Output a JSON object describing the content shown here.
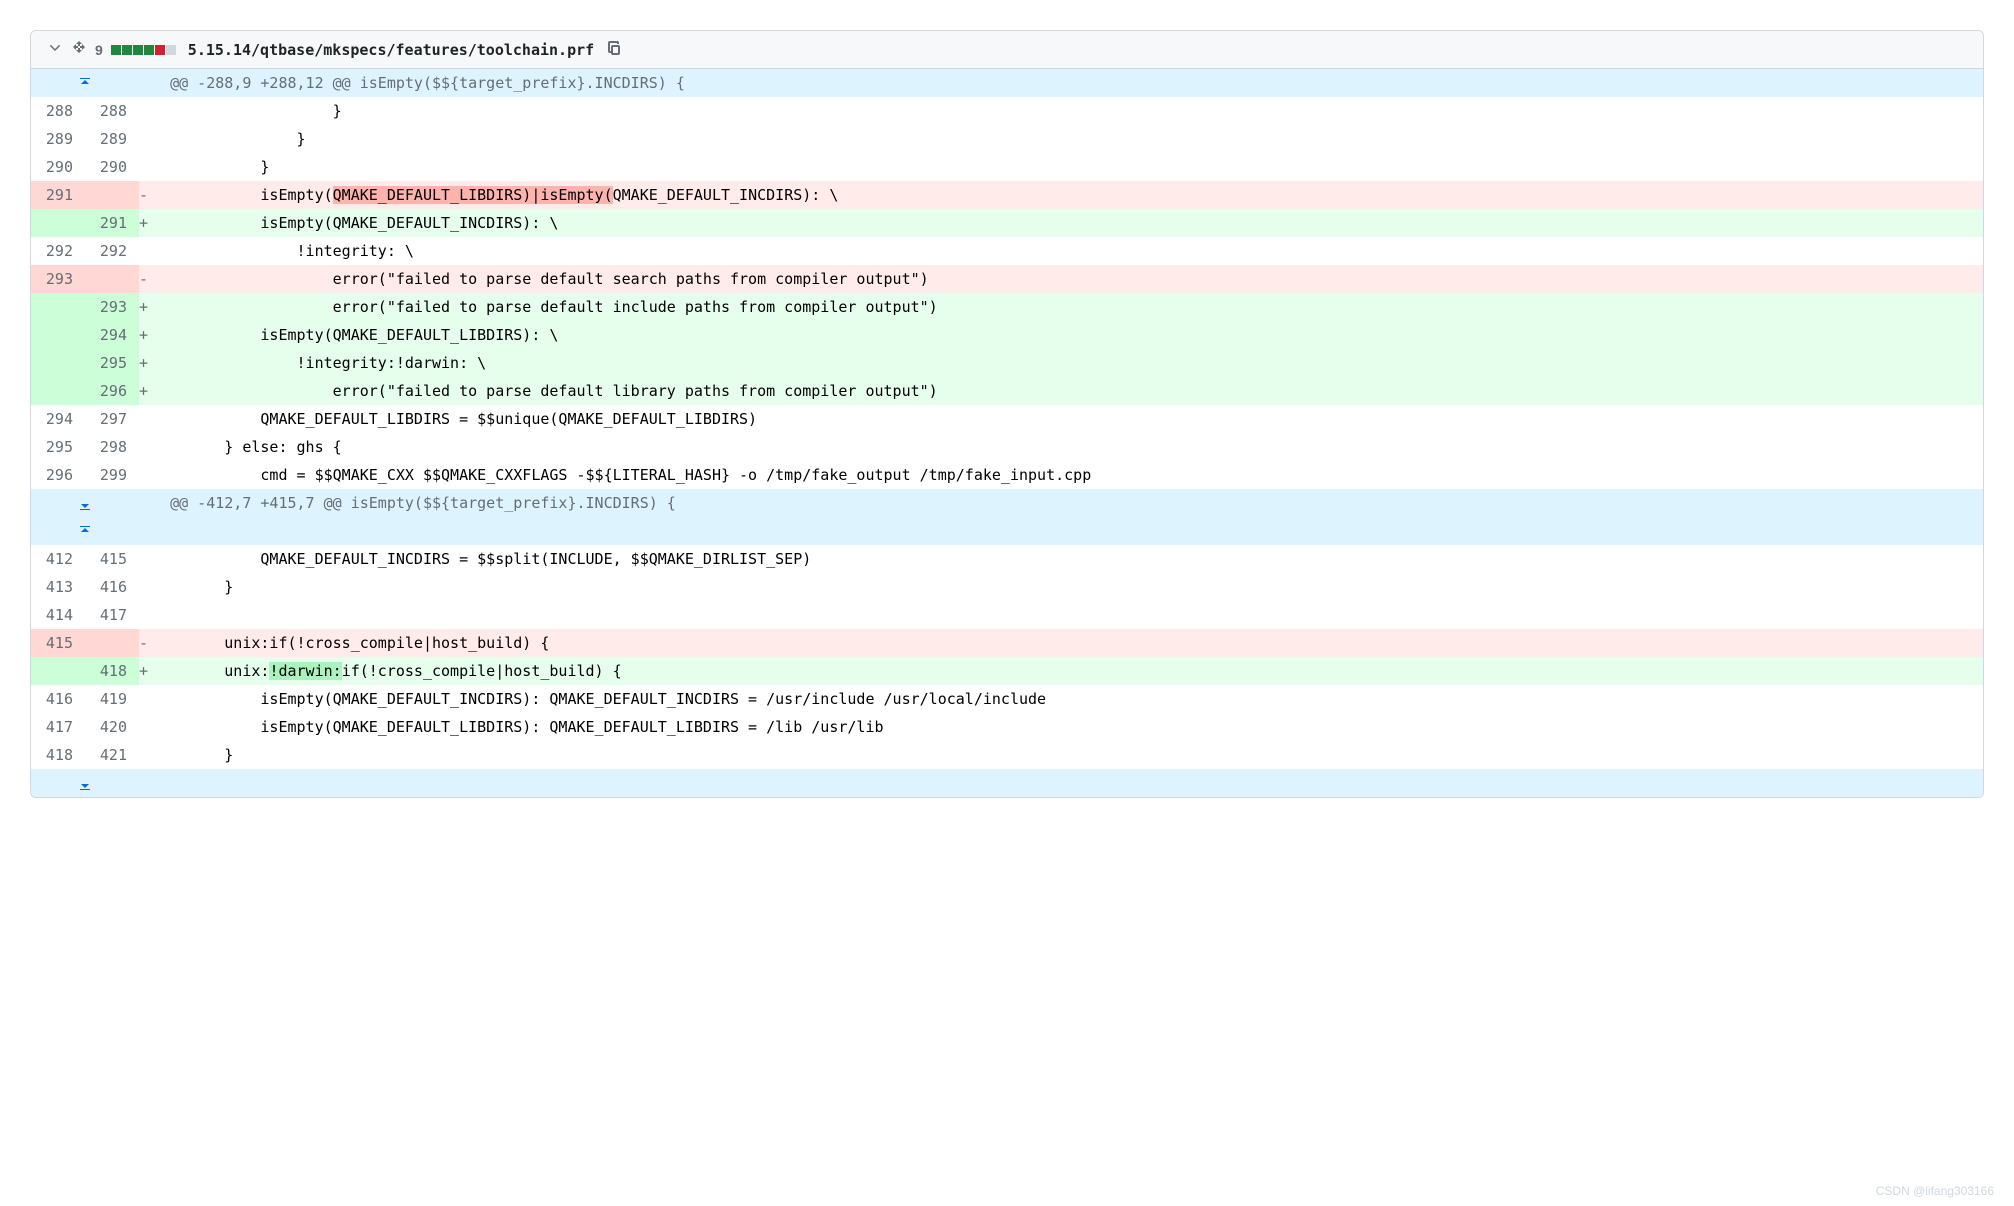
{
  "header": {
    "change_count": "9",
    "file_path": "5.15.14/qtbase/mkspecs/features/toolchain.prf",
    "stat_blocks": [
      "add",
      "add",
      "add",
      "add",
      "del",
      "neutral"
    ]
  },
  "hunks": [
    {
      "header": "@@ -288,9 +288,12 @@ isEmpty($${target_prefix}.INCDIRS) {",
      "expand_up": true,
      "expand_down": false
    },
    {
      "header": "@@ -412,7 +415,7 @@ isEmpty($${target_prefix}.INCDIRS) {",
      "expand_up": true,
      "expand_down": true
    }
  ],
  "rows": [
    {
      "type": "ctx",
      "old": "288",
      "new": "288",
      "code": "                    }"
    },
    {
      "type": "ctx",
      "old": "289",
      "new": "289",
      "code": "                }"
    },
    {
      "type": "ctx",
      "old": "290",
      "new": "290",
      "code": "            }"
    },
    {
      "type": "del",
      "old": "291",
      "new": "",
      "code_pre": "            isEmpty(",
      "hl": "QMAKE_DEFAULT_LIBDIRS)|isEmpty(",
      "code_post": "QMAKE_DEFAULT_INCDIRS): \\"
    },
    {
      "type": "add",
      "old": "",
      "new": "291",
      "code": "            isEmpty(QMAKE_DEFAULT_INCDIRS): \\"
    },
    {
      "type": "ctx",
      "old": "292",
      "new": "292",
      "code": "                !integrity: \\"
    },
    {
      "type": "del",
      "old": "293",
      "new": "",
      "code": "                    error(\"failed to parse default search paths from compiler output\")"
    },
    {
      "type": "add",
      "old": "",
      "new": "293",
      "code": "                    error(\"failed to parse default include paths from compiler output\")"
    },
    {
      "type": "add",
      "old": "",
      "new": "294",
      "code": "            isEmpty(QMAKE_DEFAULT_LIBDIRS): \\"
    },
    {
      "type": "add",
      "old": "",
      "new": "295",
      "code": "                !integrity:!darwin: \\"
    },
    {
      "type": "add",
      "old": "",
      "new": "296",
      "code": "                    error(\"failed to parse default library paths from compiler output\")"
    },
    {
      "type": "ctx",
      "old": "294",
      "new": "297",
      "code": "            QMAKE_DEFAULT_LIBDIRS = $$unique(QMAKE_DEFAULT_LIBDIRS)"
    },
    {
      "type": "ctx",
      "old": "295",
      "new": "298",
      "code": "        } else: ghs {"
    },
    {
      "type": "ctx",
      "old": "296",
      "new": "299",
      "code": "            cmd = $$QMAKE_CXX $$QMAKE_CXXFLAGS -$${LITERAL_HASH} -o /tmp/fake_output /tmp/fake_input.cpp"
    }
  ],
  "rows2": [
    {
      "type": "ctx",
      "old": "412",
      "new": "415",
      "code": "            QMAKE_DEFAULT_INCDIRS = $$split(INCLUDE, $$QMAKE_DIRLIST_SEP)"
    },
    {
      "type": "ctx",
      "old": "413",
      "new": "416",
      "code": "        }"
    },
    {
      "type": "ctx",
      "old": "414",
      "new": "417",
      "code": ""
    },
    {
      "type": "del",
      "old": "415",
      "new": "",
      "code": "        unix:if(!cross_compile|host_build) {"
    },
    {
      "type": "add",
      "old": "",
      "new": "418",
      "code_pre": "        unix:",
      "hl": "!darwin:",
      "code_post": "if(!cross_compile|host_build) {"
    },
    {
      "type": "ctx",
      "old": "416",
      "new": "419",
      "code": "            isEmpty(QMAKE_DEFAULT_INCDIRS): QMAKE_DEFAULT_INCDIRS = /usr/include /usr/local/include"
    },
    {
      "type": "ctx",
      "old": "417",
      "new": "420",
      "code": "            isEmpty(QMAKE_DEFAULT_LIBDIRS): QMAKE_DEFAULT_LIBDIRS = /lib /usr/lib"
    },
    {
      "type": "ctx",
      "old": "418",
      "new": "421",
      "code": "        }"
    }
  ],
  "watermark": "CSDN @lifang303166"
}
